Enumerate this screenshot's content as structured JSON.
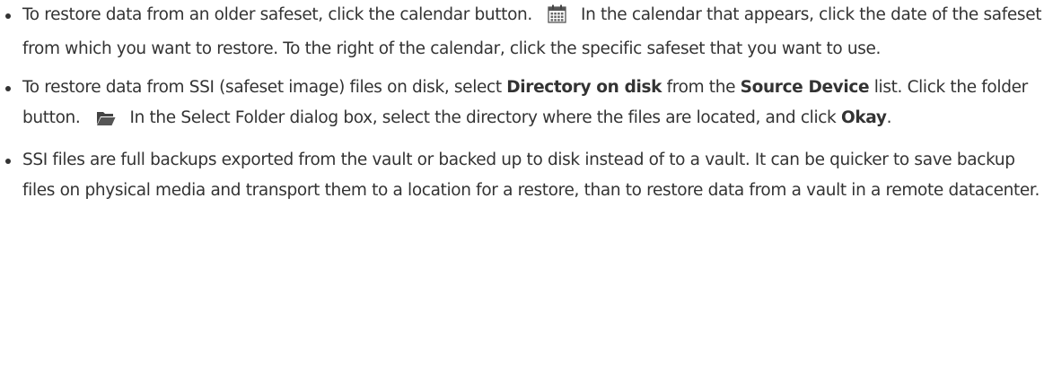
{
  "bullets": [
    {
      "segments": [
        "To restore data from an older safeset, click the calendar button. ",
        " In the calendar that appears, click the date of the safeset from which you want to restore. To the right of the calendar, click the specific safeset that you want to use."
      ],
      "icon": "calendar-icon"
    },
    {
      "segments": [
        "To restore data from SSI (safeset image) files on disk, select ",
        "Directory on disk",
        " from the ",
        "Source Device",
        " list. Click the folder button. ",
        " In the Select Folder dialog box, select the directory where the files are located, and click ",
        "Okay",
        "."
      ],
      "icon": "folder-open-icon"
    },
    {
      "segments": [
        "SSI files are full backups exported from the vault or backed up to disk instead of to a vault. It can be quicker to save backup files on physical media and transport them to a location for a restore, than to restore data from a vault in a remote datacenter."
      ]
    }
  ]
}
